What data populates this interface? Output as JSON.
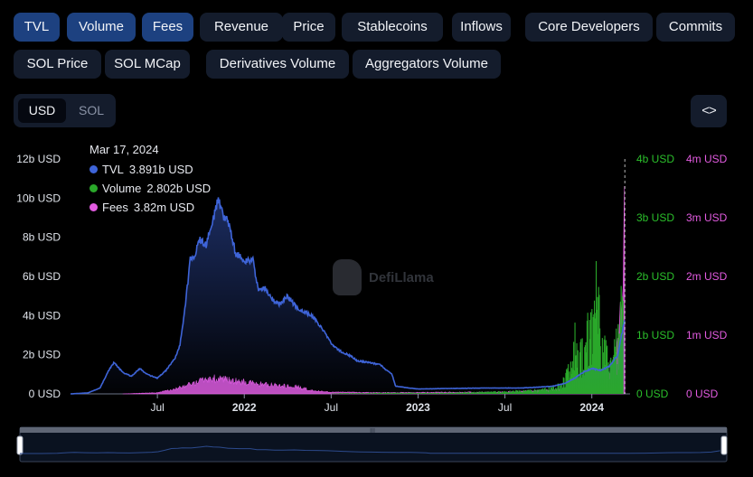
{
  "tabs": [
    {
      "label": "TVL",
      "active": true
    },
    {
      "label": "Volume",
      "active": true
    },
    {
      "label": "Fees",
      "active": true
    },
    {
      "label": "Revenue",
      "active": false
    },
    {
      "label": "Price",
      "active": false
    },
    {
      "label": "Stablecoins",
      "active": false
    },
    {
      "label": "Inflows",
      "active": false
    },
    {
      "label": "Core Developers",
      "active": false
    },
    {
      "label": "Commits",
      "active": false
    },
    {
      "label": "SOL Price",
      "active": false
    },
    {
      "label": "SOL MCap",
      "active": false
    },
    {
      "label": "Derivatives Volume",
      "active": false
    },
    {
      "label": "Aggregators Volume",
      "active": false
    }
  ],
  "unit_toggle": {
    "options": [
      "USD",
      "SOL"
    ],
    "selected": "USD"
  },
  "embed_button": {
    "icon": "code-brackets-icon",
    "label": "<>"
  },
  "tooltip": {
    "date": "Mar 17, 2024",
    "rows": [
      {
        "name": "TVL",
        "value": "3.891b USD",
        "color": "#3e64d8"
      },
      {
        "name": "Volume",
        "value": "2.802b USD",
        "color": "#2aa82a"
      },
      {
        "name": "Fees",
        "value": "3.82m USD",
        "color": "#e25be0"
      }
    ]
  },
  "watermark": {
    "text": "DefiLlama",
    "icon": "llama-icon"
  },
  "range_slider": {
    "handle_label": "III"
  },
  "colors": {
    "tvl": "#3e64d8",
    "volume": "#2aa82a",
    "fees": "#e25be0",
    "axis_left": "#dfe3ea",
    "axis_volume": "#2bbf2b",
    "axis_fees": "#e25be0",
    "tab_bg": "#141c2c",
    "tab_active": "#1d4180"
  },
  "chart_data": {
    "type": "area",
    "x_ticks": [
      "Jul",
      "2022",
      "Jul",
      "2023",
      "Jul",
      "2024"
    ],
    "y_left": {
      "ticks": [
        "0 USD",
        "2b USD",
        "4b USD",
        "6b USD",
        "8b USD",
        "10b USD",
        "12b USD"
      ],
      "range": [
        0,
        12
      ]
    },
    "y_volume": {
      "ticks": [
        "0 USD",
        "1b USD",
        "2b USD",
        "3b USD",
        "4b USD"
      ],
      "range": [
        0,
        4
      ]
    },
    "y_fees": {
      "ticks": [
        "0 USD",
        "1m USD",
        "2m USD",
        "3m USD",
        "4m USD"
      ],
      "range": [
        0,
        4
      ]
    },
    "x_range": [
      2021.0,
      2024.22
    ],
    "series": [
      {
        "name": "TVL",
        "unit": "b USD",
        "points": [
          [
            2021.0,
            0.0
          ],
          [
            2021.1,
            0.05
          ],
          [
            2021.17,
            0.3
          ],
          [
            2021.22,
            1.2
          ],
          [
            2021.25,
            1.6
          ],
          [
            2021.3,
            1.1
          ],
          [
            2021.35,
            0.9
          ],
          [
            2021.4,
            1.3
          ],
          [
            2021.44,
            1.0
          ],
          [
            2021.5,
            0.8
          ],
          [
            2021.55,
            1.2
          ],
          [
            2021.6,
            1.8
          ],
          [
            2021.63,
            2.5
          ],
          [
            2021.66,
            4.5
          ],
          [
            2021.69,
            6.9
          ],
          [
            2021.72,
            7.1
          ],
          [
            2021.74,
            7.9
          ],
          [
            2021.78,
            7.6
          ],
          [
            2021.82,
            8.9
          ],
          [
            2021.85,
            10.0
          ],
          [
            2021.88,
            9.1
          ],
          [
            2021.91,
            8.7
          ],
          [
            2021.95,
            7.2
          ],
          [
            2022.0,
            6.8
          ],
          [
            2022.05,
            6.8
          ],
          [
            2022.08,
            5.3
          ],
          [
            2022.12,
            5.4
          ],
          [
            2022.16,
            4.8
          ],
          [
            2022.2,
            4.6
          ],
          [
            2022.25,
            5.0
          ],
          [
            2022.3,
            4.4
          ],
          [
            2022.35,
            4.2
          ],
          [
            2022.4,
            3.9
          ],
          [
            2022.45,
            3.3
          ],
          [
            2022.5,
            2.6
          ],
          [
            2022.55,
            2.2
          ],
          [
            2022.6,
            2.0
          ],
          [
            2022.65,
            1.7
          ],
          [
            2022.72,
            1.6
          ],
          [
            2022.78,
            1.5
          ],
          [
            2022.82,
            1.2
          ],
          [
            2022.85,
            1.0
          ],
          [
            2022.87,
            0.4
          ],
          [
            2022.95,
            0.3
          ],
          [
            2023.0,
            0.25
          ],
          [
            2023.2,
            0.28
          ],
          [
            2023.4,
            0.3
          ],
          [
            2023.6,
            0.3
          ],
          [
            2023.7,
            0.35
          ],
          [
            2023.78,
            0.4
          ],
          [
            2023.85,
            0.55
          ],
          [
            2023.9,
            0.8
          ],
          [
            2023.95,
            1.1
          ],
          [
            2024.0,
            1.3
          ],
          [
            2024.05,
            1.2
          ],
          [
            2024.1,
            1.4
          ],
          [
            2024.15,
            2.0
          ],
          [
            2024.19,
            3.9
          ]
        ]
      },
      {
        "name": "Volume",
        "unit": "b USD",
        "points": [
          [
            2022.5,
            0.01
          ],
          [
            2022.8,
            0.02
          ],
          [
            2023.0,
            0.02
          ],
          [
            2023.3,
            0.03
          ],
          [
            2023.5,
            0.05
          ],
          [
            2023.7,
            0.08
          ],
          [
            2023.8,
            0.15
          ],
          [
            2023.85,
            0.4
          ],
          [
            2023.88,
            0.6
          ],
          [
            2023.9,
            1.4
          ],
          [
            2023.92,
            0.9
          ],
          [
            2023.95,
            1.0
          ],
          [
            2023.98,
            1.5
          ],
          [
            2024.0,
            1.4
          ],
          [
            2024.03,
            2.4
          ],
          [
            2024.05,
            0.9
          ],
          [
            2024.08,
            1.0
          ],
          [
            2024.1,
            0.7
          ],
          [
            2024.12,
            0.8
          ],
          [
            2024.15,
            1.2
          ],
          [
            2024.17,
            1.8
          ],
          [
            2024.18,
            2.8
          ]
        ]
      },
      {
        "name": "Fees",
        "unit": "m USD",
        "points": [
          [
            2021.3,
            0.0
          ],
          [
            2021.5,
            0.02
          ],
          [
            2021.6,
            0.08
          ],
          [
            2021.7,
            0.18
          ],
          [
            2021.8,
            0.26
          ],
          [
            2021.9,
            0.24
          ],
          [
            2022.0,
            0.2
          ],
          [
            2022.1,
            0.16
          ],
          [
            2022.2,
            0.14
          ],
          [
            2022.3,
            0.12
          ],
          [
            2022.4,
            0.05
          ],
          [
            2022.5,
            0.03
          ],
          [
            2022.8,
            0.02
          ],
          [
            2023.5,
            0.03
          ],
          [
            2023.9,
            0.08
          ],
          [
            2024.0,
            0.2
          ],
          [
            2024.1,
            0.3
          ],
          [
            2024.15,
            0.8
          ],
          [
            2024.18,
            2.0
          ],
          [
            2024.19,
            3.82
          ]
        ]
      }
    ]
  }
}
